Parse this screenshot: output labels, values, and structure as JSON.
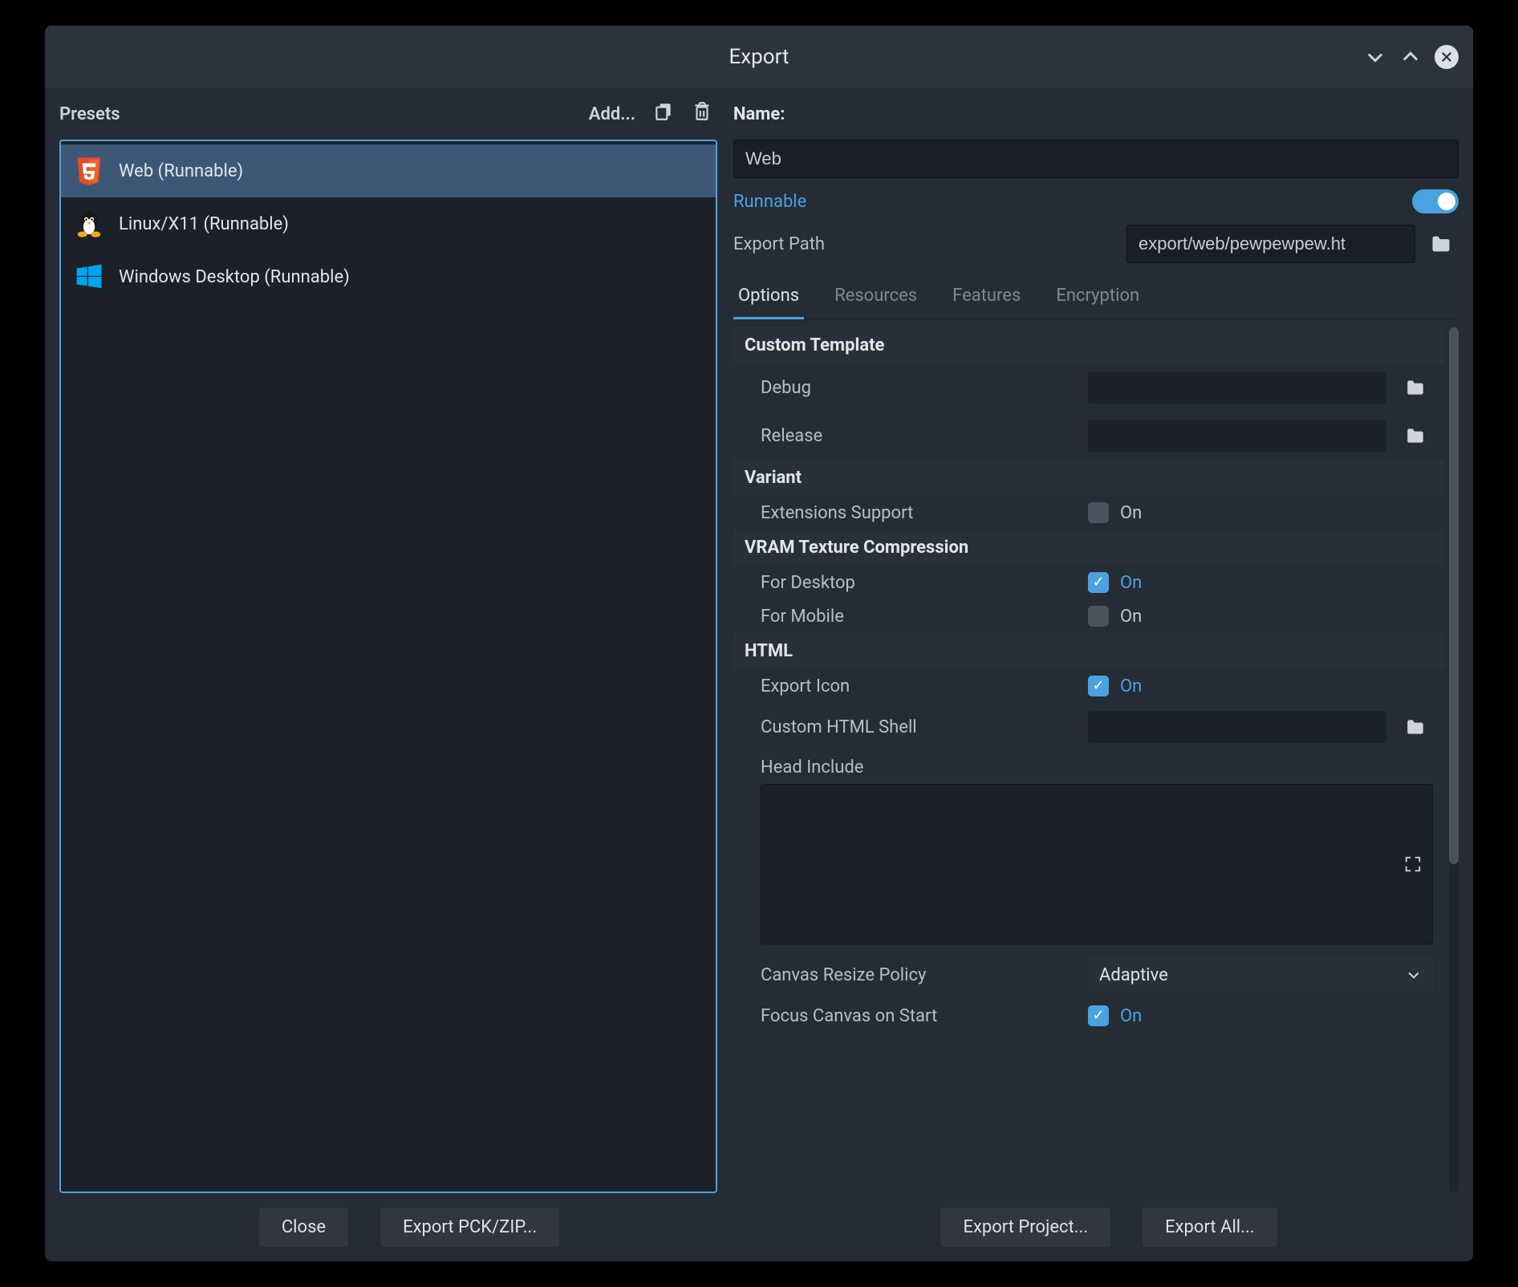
{
  "title": "Export",
  "presets_label": "Presets",
  "add_label": "Add...",
  "presets": [
    {
      "label": "Web (Runnable)",
      "icon": "html5"
    },
    {
      "label": "Linux/X11 (Runnable)",
      "icon": "linux"
    },
    {
      "label": "Windows Desktop (Runnable)",
      "icon": "windows"
    }
  ],
  "name_label": "Name:",
  "name_value": "Web",
  "runnable_label": "Runnable",
  "export_path_label": "Export Path",
  "export_path_value": "export/web/pewpewpew.ht",
  "tabs": {
    "options": "Options",
    "resources": "Resources",
    "features": "Features",
    "encryption": "Encryption"
  },
  "groups": {
    "custom_template": "Custom Template",
    "debug": "Debug",
    "release": "Release",
    "variant": "Variant",
    "extensions_support": "Extensions Support",
    "vram": "VRAM Texture Compression",
    "for_desktop": "For Desktop",
    "for_mobile": "For Mobile",
    "html": "HTML",
    "export_icon": "Export Icon",
    "custom_html_shell": "Custom HTML Shell",
    "head_include": "Head Include",
    "canvas_resize_policy": "Canvas Resize Policy",
    "canvas_resize_value": "Adaptive",
    "focus_canvas": "Focus Canvas on Start"
  },
  "on_label": "On",
  "footer": {
    "close": "Close",
    "export_pck": "Export PCK/ZIP...",
    "export_project": "Export Project...",
    "export_all": "Export All..."
  }
}
